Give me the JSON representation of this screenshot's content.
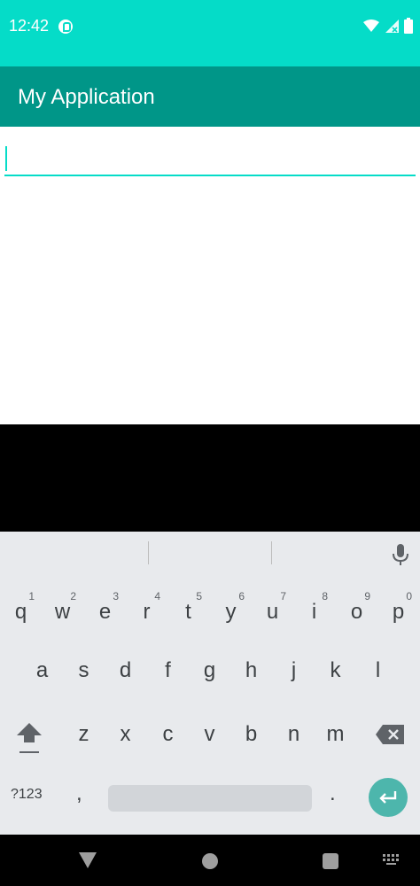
{
  "status_bar": {
    "time": "12:42",
    "icons": [
      "app-notification-icon",
      "wifi-icon",
      "signal-icon",
      "battery-icon"
    ],
    "background": "#05DCC8"
  },
  "app_bar": {
    "title": "My Application",
    "background": "#009688"
  },
  "edit_text": {
    "value": "",
    "placeholder": "",
    "accent": "#05DCC8"
  },
  "keyboard": {
    "row1": [
      {
        "key": "q",
        "hint": "1"
      },
      {
        "key": "w",
        "hint": "2"
      },
      {
        "key": "e",
        "hint": "3"
      },
      {
        "key": "r",
        "hint": "4"
      },
      {
        "key": "t",
        "hint": "5"
      },
      {
        "key": "y",
        "hint": "6"
      },
      {
        "key": "u",
        "hint": "7"
      },
      {
        "key": "i",
        "hint": "8"
      },
      {
        "key": "o",
        "hint": "9"
      },
      {
        "key": "p",
        "hint": "0"
      }
    ],
    "row2": [
      "a",
      "s",
      "d",
      "f",
      "g",
      "h",
      "j",
      "k",
      "l"
    ],
    "row3": [
      "z",
      "x",
      "c",
      "v",
      "b",
      "n",
      "m"
    ],
    "bottom": {
      "symbols": "?123",
      "comma": ",",
      "period": "."
    },
    "icons": {
      "mic": "mic-icon",
      "shift": "shift-icon",
      "backspace": "backspace-icon",
      "enter": "enter-icon"
    },
    "enter_color": "#4DB6AC"
  },
  "nav_bar": {
    "icons": [
      "back-icon",
      "home-icon",
      "recents-icon",
      "keyboard-switch-icon"
    ]
  }
}
